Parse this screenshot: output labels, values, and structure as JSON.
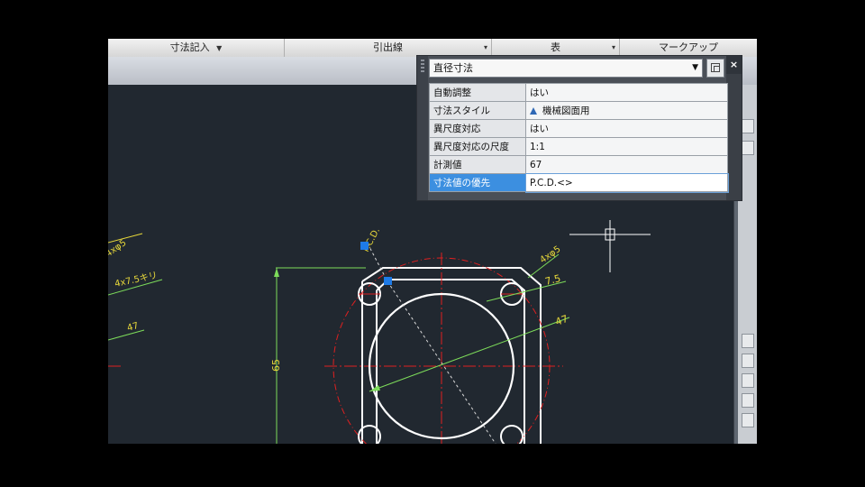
{
  "ribbon": {
    "groups": [
      {
        "label": "寸法記入",
        "chevron": "▼"
      },
      {
        "label": "引出線",
        "chevron": "▾"
      },
      {
        "label": "表",
        "chevron": "▾"
      },
      {
        "label": "マークアップ",
        "chevron": ""
      }
    ]
  },
  "quick_properties": {
    "object_type": "直径寸法",
    "dropdown_icon": "chevron-down-icon",
    "close_label": "×",
    "rows": [
      {
        "key": "自動調整",
        "value": "はい"
      },
      {
        "key": "寸法スタイル",
        "value": "機械図面用",
        "icon": "dimstyle-triangle-icon"
      },
      {
        "key": "異尺度対応",
        "value": "はい"
      },
      {
        "key": "異尺度対応の尺度",
        "value": "1:1"
      },
      {
        "key": "計測値",
        "value": "67"
      },
      {
        "key": "寸法値の優先",
        "value": "P.C.D.<>",
        "selected": true
      }
    ]
  },
  "drawing": {
    "labels": {
      "pcd": "P.C.D.",
      "four_x_phi6": "4xφ5",
      "four_x_7_5": "4x7.5キリ",
      "dim_47_left": "47",
      "dim_7_5": "7.5",
      "dim_47_right": "47",
      "dim_65": "65",
      "four_x_phi6_right": "4xφ5"
    },
    "colors": {
      "background": "#212830",
      "outline": "#ffffff",
      "centerline": "#e02020",
      "dimension": "#7ddc5a",
      "text": "#e7d83a",
      "grip": "#1e7be8"
    }
  }
}
